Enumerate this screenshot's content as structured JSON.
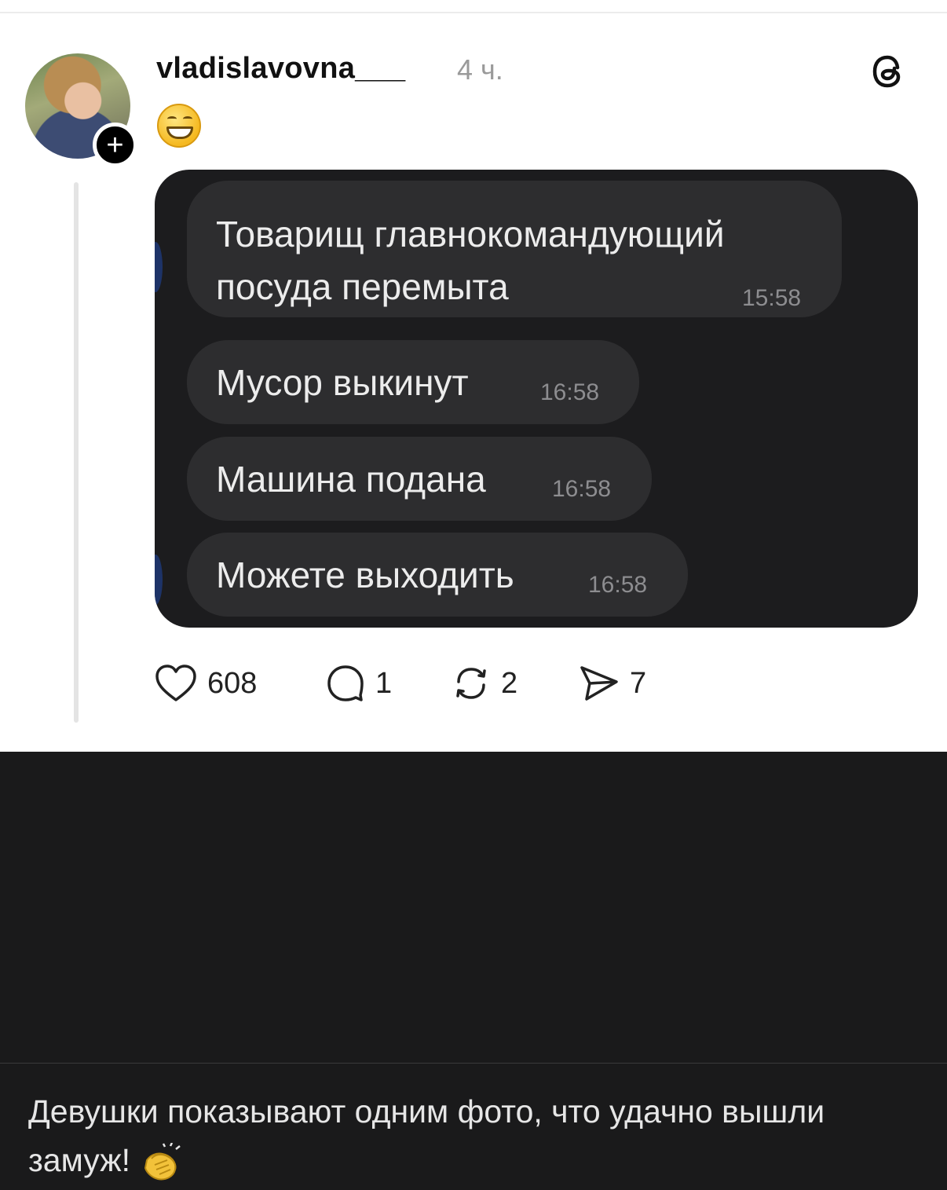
{
  "post": {
    "username": "vladislavovna___",
    "time_ago": "4 ч.",
    "follow_symbol": "+",
    "emoji_icon": "grinning-face-emoji",
    "threads_icon": "threads-logo-icon"
  },
  "chat_messages": [
    {
      "lines": [
        "Товарищ главнокомандующий",
        "посуда перемыта"
      ],
      "time": "15:58"
    },
    {
      "lines": [
        "Мусор выкинут"
      ],
      "time": "16:58"
    },
    {
      "lines": [
        "Машина подана"
      ],
      "time": "16:58"
    },
    {
      "lines": [
        "Можете выходить"
      ],
      "time": "16:58"
    }
  ],
  "actions": {
    "likes": "608",
    "replies": "1",
    "reposts": "2",
    "shares": "7"
  },
  "caption": {
    "text": "Девушки показывают одним фото, что удачно вышли замуж!",
    "emoji_icon": "clapping-hands-emoji"
  },
  "colors": {
    "chat_background": "#1c1c1e",
    "bubble_background": "#2d2d2f",
    "page_dark": "#1a1a1b"
  }
}
